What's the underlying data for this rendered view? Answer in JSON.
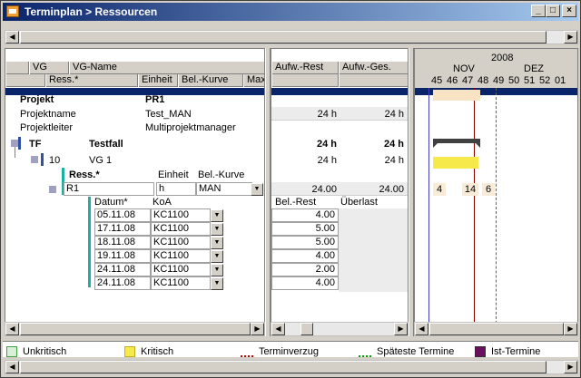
{
  "window": {
    "title": "Terminplan > Ressourcen",
    "min": "_",
    "max": "□",
    "close": "×"
  },
  "grid": {
    "header_row1": [
      "VG",
      "VG-Name"
    ],
    "header_row2": [
      "Ress.*",
      "Einheit",
      "Bel.-Kurve",
      "Max"
    ],
    "rows": {
      "projekt_label": "Projekt",
      "projekt_value": "PR1",
      "projektname_label": "Projektname",
      "projektname_value": "Test_MAN",
      "projektleiter_label": "Projektleiter",
      "projektleiter_value": "Multiprojektmanager",
      "tf_code": "TF",
      "tf_name": "Testfall",
      "vg_code": "10",
      "vg_name": "VG 1",
      "ress_header": "Ress.*",
      "einheit_header": "Einheit",
      "kurve_header": "Bel.-Kurve",
      "r1_code": "R1",
      "r1_unit": "h",
      "r1_kurve": "MAN",
      "datum_header": "Datum*",
      "koa_header": "KoA"
    },
    "detail_rows": [
      {
        "datum": "05.11.08",
        "koa": "KC1100",
        "rest": "4.00"
      },
      {
        "datum": "17.11.08",
        "koa": "KC1100",
        "rest": "5.00"
      },
      {
        "datum": "18.11.08",
        "koa": "KC1100",
        "rest": "5.00"
      },
      {
        "datum": "19.11.08",
        "koa": "KC1100",
        "rest": "4.00"
      },
      {
        "datum": "24.11.08",
        "koa": "KC1100",
        "rest": "2.00"
      },
      {
        "datum": "24.11.08",
        "koa": "KC1100",
        "rest": "4.00"
      }
    ]
  },
  "mid": {
    "headers": [
      "Aufw.-Rest",
      "Aufw.-Ges."
    ],
    "projektname_rest": "24 h",
    "projektname_ges": "24 h",
    "tf_rest": "24 h",
    "tf_ges": "24 h",
    "vg_rest": "24 h",
    "vg_ges": "24 h",
    "r1_rest": "24.00",
    "r1_ges": "24.00",
    "detail_headers": [
      "Bel.-Rest",
      "Überlast"
    ]
  },
  "gantt": {
    "year": "2008",
    "months": [
      "NOV",
      "DEZ"
    ],
    "weeks": [
      "45",
      "46",
      "47",
      "48",
      "49",
      "50",
      "51",
      "52",
      "01"
    ],
    "r1_labels": [
      "4",
      "14",
      "6"
    ],
    "colors": {
      "critical": "#f5e94b",
      "planned": "#f8e3c4",
      "summary": "#404040",
      "today": "#8b0000",
      "line": "#4040c0"
    }
  },
  "legend": {
    "items": [
      "Unkritisch",
      "Kritisch",
      "Terminverzug",
      "Späteste Termine",
      "Ist-Termine"
    ],
    "colors": {
      "unkritisch": "#d8f0d8",
      "kritisch": "#f5e94b",
      "terminverzug": "#c00000",
      "spaeteste": "#00a000",
      "ist": "#6b1060"
    }
  }
}
